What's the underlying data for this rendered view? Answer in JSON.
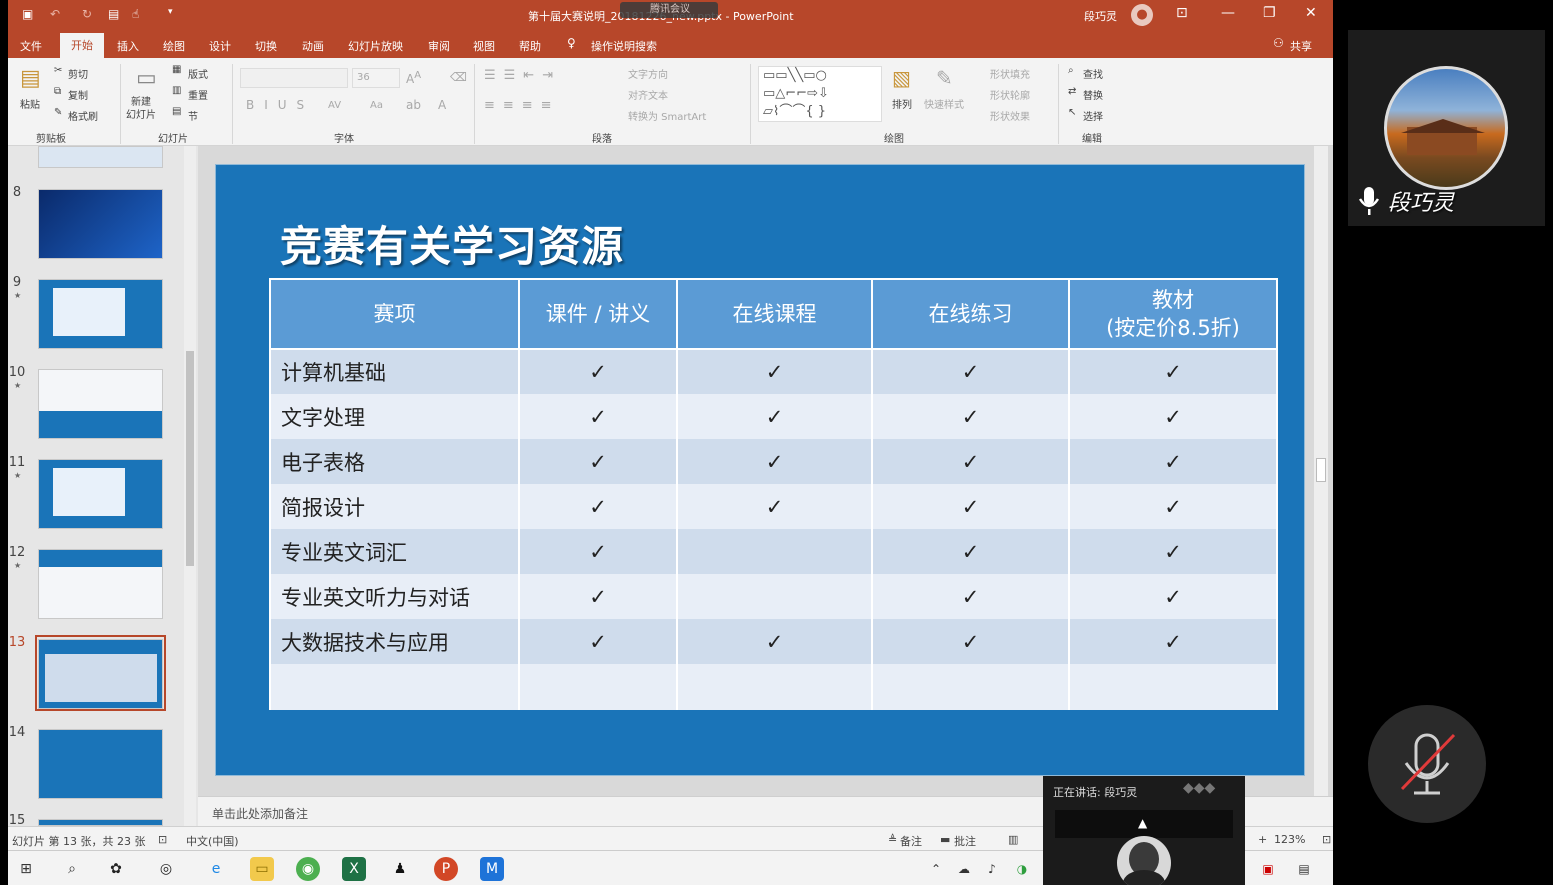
{
  "titlebar": {
    "title": "第十届大赛说明_20181226_new.pptx - PowerPoint",
    "meeting_label": "腾讯会议",
    "user": "段巧灵"
  },
  "menu": {
    "tabs": [
      "文件",
      "开始",
      "插入",
      "绘图",
      "设计",
      "切换",
      "动画",
      "幻灯片放映",
      "审阅",
      "视图",
      "帮助",
      "操作说明搜索"
    ],
    "share": "共享",
    "active_tab": "开始"
  },
  "ribbon": {
    "clipboard": {
      "paste": "粘贴",
      "cut": "剪切",
      "copy": "复制",
      "format_painter": "格式刷",
      "group": "剪贴板"
    },
    "slides": {
      "new_slide": "新建\n幻灯片",
      "layout": "版式",
      "reset": "重置",
      "section": "节",
      "group": "幻灯片"
    },
    "font": {
      "size": "36",
      "group": "字体"
    },
    "paragraph": {
      "text_direction": "文字方向",
      "align_text": "对齐文本",
      "smartart": "转换为 SmartArt",
      "group": "段落"
    },
    "drawing": {
      "arrange": "排列",
      "quick_styles": "快速样式",
      "shape_fill": "形状填充",
      "shape_outline": "形状轮廓",
      "shape_effects": "形状效果",
      "group": "绘图"
    },
    "editing": {
      "find": "查找",
      "replace": "替换",
      "select": "选择",
      "group": "编辑"
    }
  },
  "thumbnails": [
    {
      "num": "8",
      "star": false
    },
    {
      "num": "9",
      "star": true
    },
    {
      "num": "10",
      "star": true
    },
    {
      "num": "11",
      "star": true
    },
    {
      "num": "12",
      "star": true
    },
    {
      "num": "13",
      "star": false,
      "selected": true
    },
    {
      "num": "14",
      "star": false
    },
    {
      "num": "15",
      "star": false
    }
  ],
  "slide": {
    "title": "竞赛有关学习资源",
    "headers": [
      "赛项",
      "课件 / 讲义",
      "在线课程",
      "在线练习",
      "教材\n(按定价8.5折)"
    ],
    "rows": [
      [
        "计算机基础",
        "✓",
        "✓",
        "✓",
        "✓"
      ],
      [
        "文字处理",
        "✓",
        "✓",
        "✓",
        "✓"
      ],
      [
        "电子表格",
        "✓",
        "✓",
        "✓",
        "✓"
      ],
      [
        "简报设计",
        "✓",
        "✓",
        "✓",
        "✓"
      ],
      [
        "专业英文词汇",
        "✓",
        "",
        "✓",
        "✓"
      ],
      [
        "专业英文听力与对话",
        "✓",
        "",
        "✓",
        "✓"
      ],
      [
        "大数据技术与应用",
        "✓",
        "✓",
        "✓",
        "✓"
      ]
    ]
  },
  "notes_placeholder": "单击此处添加备注",
  "status": {
    "slide_info": "幻灯片 第 13 张，共 23 张",
    "language": "中文(中国)",
    "notes": "备注",
    "comments": "批注",
    "zoom": "123%"
  },
  "meeting": {
    "participant_name": "段巧灵",
    "speaking_label": "正在讲话: 段巧灵"
  },
  "colors": {
    "accent": "#b7472a",
    "slide_bg": "#1a74b8",
    "table_header": "#5b9bd5"
  }
}
